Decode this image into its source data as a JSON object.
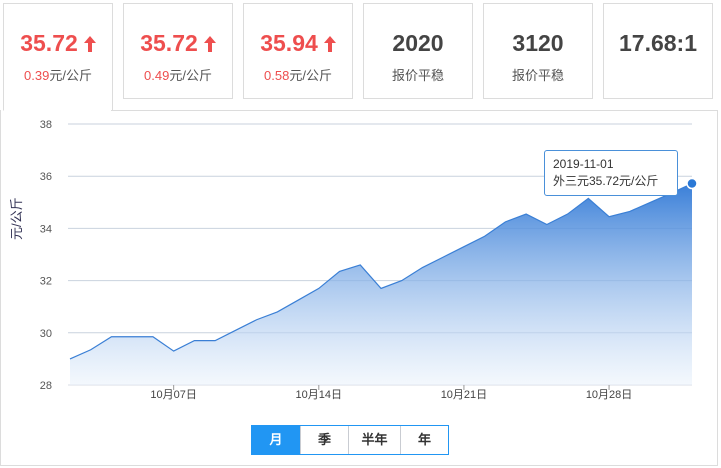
{
  "cards": [
    {
      "value": "35.72",
      "trend": "up",
      "change_num": "0.39",
      "change_unit": "元/公斤",
      "active": true
    },
    {
      "value": "35.72",
      "trend": "up",
      "change_num": "0.49",
      "change_unit": "元/公斤",
      "active": false
    },
    {
      "value": "35.94",
      "trend": "up",
      "change_num": "0.58",
      "change_unit": "元/公斤",
      "active": false
    },
    {
      "value": "2020",
      "trend": "flat",
      "sub": "报价平稳",
      "active": false
    },
    {
      "value": "3120",
      "trend": "flat",
      "sub": "报价平稳",
      "active": false
    },
    {
      "value": "17.68:1",
      "trend": "flat",
      "sub": "",
      "active": false
    }
  ],
  "tooltip": {
    "date": "2019-11-01",
    "text": "外三元35.72元/公斤"
  },
  "tabs": [
    {
      "label": "月",
      "selected": true
    },
    {
      "label": "季",
      "selected": false
    },
    {
      "label": "半年",
      "selected": false
    },
    {
      "label": "年",
      "selected": false
    }
  ],
  "colors": {
    "up": "#ee4e4e",
    "line": "#3a7fd5",
    "accent": "#2196f3"
  },
  "chart_data": {
    "type": "area",
    "ylabel": "元/公斤",
    "ylim": [
      28,
      38
    ],
    "yticks": [
      28,
      30,
      32,
      34,
      36,
      38
    ],
    "xticks": [
      "10月07日",
      "10月14日",
      "10月21日",
      "10月28日"
    ],
    "x": [
      "2019-10-02",
      "2019-10-03",
      "2019-10-04",
      "2019-10-05",
      "2019-10-06",
      "2019-10-07",
      "2019-10-08",
      "2019-10-09",
      "2019-10-10",
      "2019-10-11",
      "2019-10-12",
      "2019-10-13",
      "2019-10-14",
      "2019-10-15",
      "2019-10-16",
      "2019-10-17",
      "2019-10-18",
      "2019-10-19",
      "2019-10-20",
      "2019-10-21",
      "2019-10-22",
      "2019-10-23",
      "2019-10-24",
      "2019-10-25",
      "2019-10-26",
      "2019-10-27",
      "2019-10-28",
      "2019-10-29",
      "2019-10-30",
      "2019-10-31",
      "2019-11-01"
    ],
    "series": [
      {
        "name": "外三元",
        "values": [
          29.0,
          29.35,
          29.85,
          29.85,
          29.85,
          29.3,
          29.7,
          29.7,
          30.1,
          30.5,
          30.8,
          31.25,
          31.7,
          32.35,
          32.6,
          31.7,
          32.0,
          32.5,
          32.9,
          33.3,
          33.7,
          34.25,
          34.55,
          34.15,
          34.55,
          35.15,
          34.45,
          34.65,
          35.0,
          35.35,
          35.72
        ]
      }
    ]
  }
}
